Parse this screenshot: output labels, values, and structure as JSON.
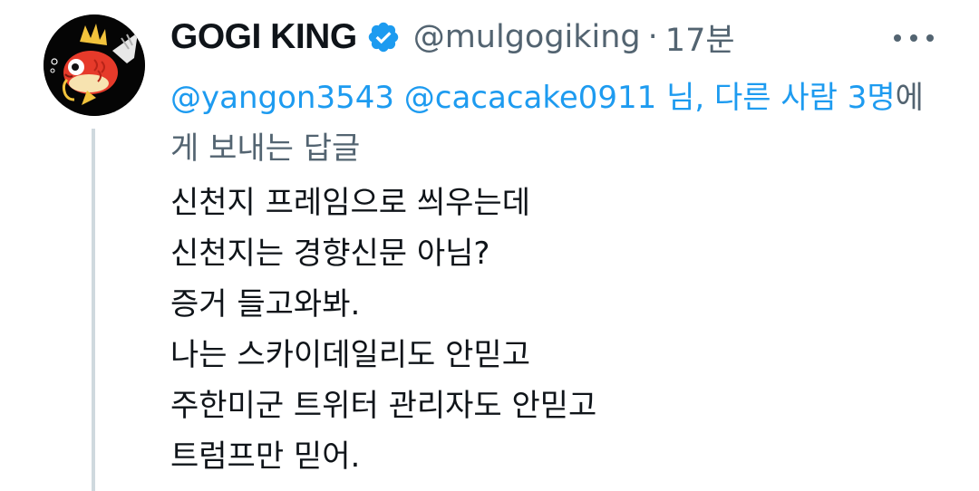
{
  "author": {
    "name": "GOGI KING",
    "handle": "@mulgogiking",
    "separator": "·",
    "time": "17분",
    "verified": true
  },
  "reply_context": {
    "mention1": "@yangon3543",
    "mention2": "@cacacake0911",
    "suffix_link": "님, 다른 사람 3명",
    "suffix_text": "에게 보내는 답글"
  },
  "body_lines": [
    "신천지 프레임으로 씌우는데",
    "신천지는 경향신문 아님?",
    "증거 들고와봐.",
    "나는 스카이데일리도 안믿고",
    "주한미군 트위터 관리자도 안믿고",
    "트럼프만 믿어."
  ],
  "colors": {
    "accent": "#1d9bf0",
    "secondary_text": "#536471",
    "primary_text": "#0f1419",
    "thread_line": "#cfd9de"
  },
  "icons": {
    "verified": "verified-badge-icon",
    "more": "more-options-icon",
    "avatar": "magikarp-fish-avatar"
  }
}
